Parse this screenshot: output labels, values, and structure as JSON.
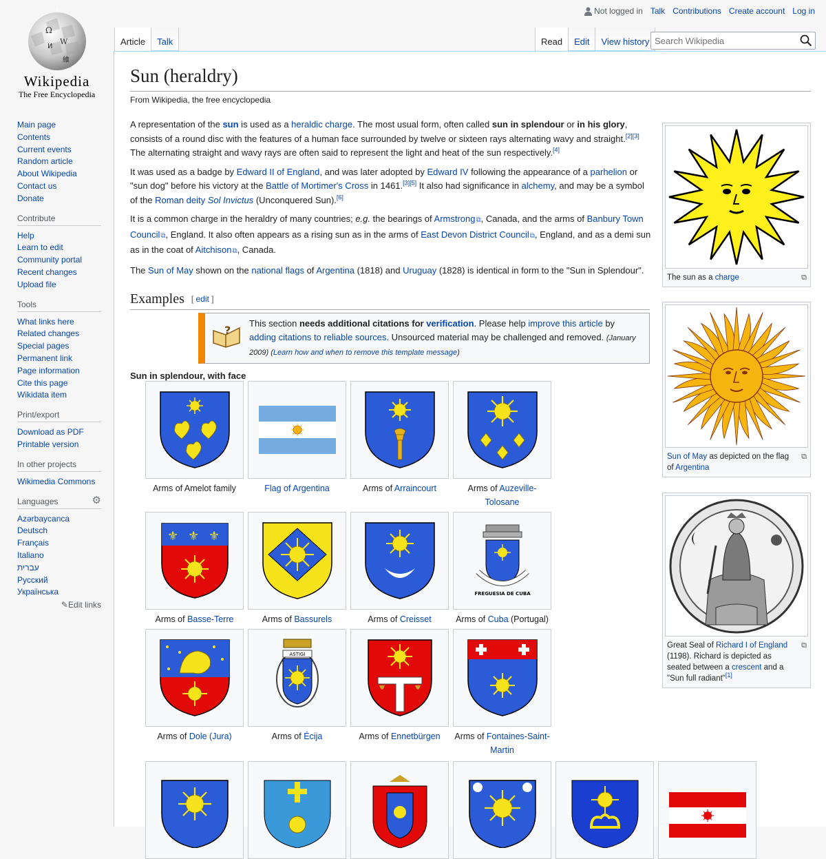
{
  "logo": {
    "wordmark": "Wikipedia",
    "tagline": "The Free Encyclopedia"
  },
  "personal": {
    "not_logged_in": "Not logged in",
    "talk": "Talk",
    "contributions": "Contributions",
    "create_account": "Create account",
    "log_in": "Log in"
  },
  "tabs": {
    "article": "Article",
    "talk": "Talk",
    "read": "Read",
    "edit": "Edit",
    "view_history": "View history"
  },
  "search": {
    "placeholder": "Search Wikipedia"
  },
  "sidebar": {
    "navigation": [
      "Main page",
      "Contents",
      "Current events",
      "Random article",
      "About Wikipedia",
      "Contact us",
      "Donate"
    ],
    "contribute": {
      "heading": "Contribute",
      "items": [
        "Help",
        "Learn to edit",
        "Community portal",
        "Recent changes",
        "Upload file"
      ]
    },
    "tools": {
      "heading": "Tools",
      "items": [
        "What links here",
        "Related changes",
        "Special pages",
        "Permanent link",
        "Page information",
        "Cite this page",
        "Wikidata item"
      ]
    },
    "print": {
      "heading": "Print/export",
      "items": [
        "Download as PDF",
        "Printable version"
      ]
    },
    "projects": {
      "heading": "In other projects",
      "items": [
        "Wikimedia Commons"
      ]
    },
    "languages": {
      "heading": "Languages",
      "items": [
        "Azərbaycanca",
        "Deutsch",
        "Français",
        "Italiano",
        "עברית",
        "Русский",
        "Українська"
      ],
      "edit_links": "Edit links"
    }
  },
  "article": {
    "title": "Sun (heraldry)",
    "site_sub": "From Wikipedia, the free encyclopedia",
    "p1": {
      "t1": "A representation of the ",
      "sun": "sun",
      "t2": " is used as a ",
      "charge_link": "heraldic charge",
      "t3": ". The most usual form, often called ",
      "b1": "sun in splendour",
      "t4": " or ",
      "b2": "in his glory",
      "t5": ", consists of a round disc with the features of a human face surrounded by twelve or sixteen rays alternating wavy and straight.",
      "ref1": "[2]",
      "ref2": "[3]",
      "t6": " The alternating straight and wavy rays are often said to represent the light and heat of the sun respectively.",
      "ref3": "[4]"
    },
    "p2": {
      "t1": "It was used as a badge by ",
      "l1": "Edward II of England",
      "t2": ", and was later adopted by ",
      "l2": "Edward IV",
      "t3": " following the appearance of a ",
      "l3": "parhelion",
      "t4": " or \"sun dog\" before his victory at the ",
      "l4": "Battle of Mortimer's Cross",
      "t5": " in 1461.",
      "ref1": "[3]",
      "ref2": "[5]",
      "t6": " It also had significance in ",
      "l5": "alchemy",
      "t7": ", and may be a symbol of the ",
      "l6": "Roman deity",
      "t8": " ",
      "l7": "Sol Invictus",
      "t9": " (Unconquered Sun).",
      "ref3": "[6]"
    },
    "p3": {
      "t1": "It is a common charge in the heraldry of many countries; ",
      "eg": "e.g.",
      "t2": " the bearings of ",
      "l1": "Armstrong",
      "t3": ", Canada, and the arms of ",
      "l2": "Banbury Town Council",
      "t4": ", England. It also often appears as a rising sun as in the arms of ",
      "l3": "East Devon District Council",
      "t5": ", England, and as a demi sun as in the coat of ",
      "l4": "Aitchison",
      "t6": ", Canada."
    },
    "p4": {
      "t1": "The ",
      "l1": "Sun of May",
      "t2": " shown on the ",
      "l2": "national flags",
      "t3": " of ",
      "l3": "Argentina",
      "t4": " (1818) and ",
      "l4": "Uruguay",
      "t5": " (1828) is identical in form to the \"Sun in Splendour\"."
    },
    "examples_heading": "Examples",
    "edit_label": "edit",
    "ambox": {
      "t1": "This section ",
      "b1": "needs additional citations for ",
      "l1": "verification",
      "t2": ". Please help ",
      "l2": "improve this article",
      "t3": " by ",
      "l3": "adding citations to reliable sources",
      "t4": ". Unsourced material may be challenged and removed. ",
      "date": "(January 2009)",
      "t5": " (",
      "l4": "Learn how and when to remove this template message",
      "t6": ")"
    },
    "subhead": "Sun in splendour, with face"
  },
  "gallery": [
    {
      "pre": "Arms of Amelot family",
      "link": "",
      "post": ""
    },
    {
      "pre": "",
      "link": "Flag of Argentina",
      "post": ""
    },
    {
      "pre": "Arms of ",
      "link": "Arraincourt",
      "post": ""
    },
    {
      "pre": "Arms of ",
      "link": "Auzeville-Tolosane",
      "post": ""
    },
    {
      "pre": "Arms of ",
      "link": "Basse-Terre",
      "post": ""
    },
    {
      "pre": "Arms of ",
      "link": "Bassurels",
      "post": ""
    },
    {
      "pre": "Arms of ",
      "link": "Creisset",
      "post": ""
    },
    {
      "pre": "Arms of ",
      "link": "Cuba",
      "post": " (Portugal)"
    },
    {
      "pre": "Arms of ",
      "link": "Dole (Jura)",
      "post": ""
    },
    {
      "pre": "Arms of ",
      "link": "Écija",
      "post": ""
    },
    {
      "pre": "Arms of ",
      "link": "Ennetbürgen",
      "post": ""
    },
    {
      "pre": "Arms of ",
      "link": "Fontaines-Saint-Martin",
      "post": ""
    }
  ],
  "thumbs": {
    "t1": {
      "pre": "The sun as a ",
      "link": "charge"
    },
    "t2": {
      "l1": "Sun of May",
      "mid": " as depicted on the flag of ",
      "l2": "Argentina"
    },
    "t3": {
      "pre": "Great Seal of ",
      "link": "Richard I of England",
      "rest": " (1198). Richard is depicted as seated between a ",
      "l2": "crescent",
      "end": " and a \"Sun full radiant\"",
      "ref": "[1]"
    }
  },
  "cuba_scroll": "FREGUESIA DE CUBA",
  "ecija_scroll": "ASTIGI",
  "colors": {
    "link": "#0645ad",
    "azure": "#2b5bd7",
    "or": "#f7e31c",
    "gules": "#e20909",
    "orange_bar": "#f28500"
  }
}
